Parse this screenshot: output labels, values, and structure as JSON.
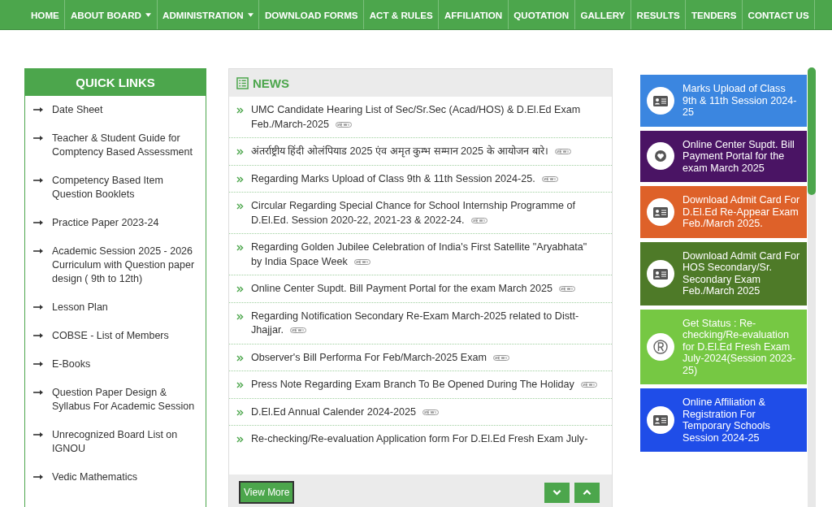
{
  "nav": [
    {
      "label": "HOME",
      "dropdown": false
    },
    {
      "label": "ABOUT BOARD",
      "dropdown": true
    },
    {
      "label": "ADMINISTRATION",
      "dropdown": true
    },
    {
      "label": "DOWNLOAD FORMS",
      "dropdown": false
    },
    {
      "label": "ACT & RULES",
      "dropdown": false
    },
    {
      "label": "AFFILIATION",
      "dropdown": false
    },
    {
      "label": "QUOTATION",
      "dropdown": false
    },
    {
      "label": "GALLERY",
      "dropdown": false
    },
    {
      "label": "RESULTS",
      "dropdown": false
    },
    {
      "label": "TENDERS",
      "dropdown": false
    },
    {
      "label": "CONTACT US",
      "dropdown": false
    }
  ],
  "quick_links": {
    "title": "QUICK LINKS",
    "items": [
      "Date Sheet",
      "Teacher & Student Guide for Comptency Based Assessment",
      "Competency Based Item Question Booklets",
      "Practice Paper 2023-24",
      "Academic Session 2025 - 2026 Curriculum with Question paper design ( 9th to 12th)",
      "Lesson Plan",
      "COBSE - List of Members",
      "E-Books",
      "Question Paper Design & Syllabus For Academic Session",
      "Unrecognized Board List on IGNOU",
      "Vedic Mathematics"
    ]
  },
  "news": {
    "title": "NEWS",
    "items": [
      {
        "text": "UMC Candidate Hearing List of Sec/Sr.Sec (Acad/HOS) & D.El.Ed Exam Feb./March-2025",
        "new": true
      },
      {
        "text": "अंतर्राष्ट्रीय हिंदी ओलंपियाड 2025 एंव अमृत कुम्भ सम्मान 2025 के आयोजन बारे।",
        "new": true
      },
      {
        "text": "Regarding Marks Upload of Class 9th & 11th Session 2024-25.",
        "new": true
      },
      {
        "text": "Circular Regarding Special Chance for School Internship Programme of D.El.Ed. Session 2020-22, 2021-23 & 2022-24.",
        "new": true
      },
      {
        "text": "Regarding Golden Jubilee Celebration of India's First Satellite \"Aryabhata\" by India Space Week",
        "new": true
      },
      {
        "text": "Online Center Supdt. Bill Payment Portal for the exam March 2025",
        "new": true
      },
      {
        "text": "Regarding Notification Secondary Re-Exam March-2025 related to Distt-Jhajjar.",
        "new": true
      },
      {
        "text": "Observer's Bill Performa For Feb/March-2025 Exam",
        "new": true
      },
      {
        "text": "Press Note Regarding Exam Branch To Be Opened During The Holiday",
        "new": true
      },
      {
        "text": "D.El.Ed Annual Calender 2024-2025",
        "new": true
      },
      {
        "text": "Re-checking/Re-evaluation Application form For D.El.Ed Fresh Exam July-",
        "new": false
      }
    ],
    "view_more": "View More"
  },
  "cards": [
    {
      "text": "Marks Upload of Class 9th & 11th Session 2024-25",
      "color": "#3b86e0",
      "kind": "id-card"
    },
    {
      "text": "Online Center Supdt. Bill Payment Portal for the exam March 2025",
      "color": "#4a1464",
      "kind": "heart"
    },
    {
      "text": "Download Admit Card For D.El.Ed Re-Appear Exam Feb./March 2025.",
      "color": "#de6129",
      "kind": "id-card"
    },
    {
      "text": "Download Admit Card For HOS Secondary/Sr. Secondary Exam Feb./March 2025",
      "color": "#4e7a28",
      "kind": "id-card"
    },
    {
      "text": "Get Status : Re-checking/Re-evaluation for D.El.Ed Fresh Exam July-2024(Session 2023-25)",
      "color": "#76c843",
      "kind": "registered"
    },
    {
      "text": "Online Affiliation & Registration For Temporary Schools Session 2024-25",
      "color": "#1f4de8",
      "kind": "id-card"
    }
  ]
}
